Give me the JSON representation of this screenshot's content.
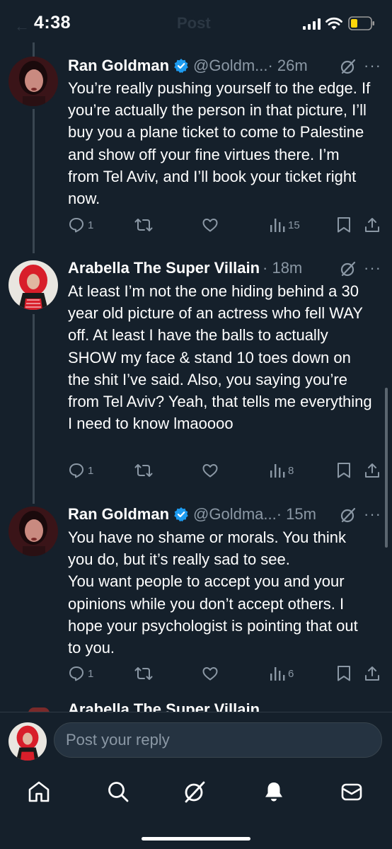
{
  "status_bar": {
    "time": "4:38",
    "ghost_title": "Post"
  },
  "tweets": [
    {
      "name": "Ran Goldman",
      "verified": true,
      "handle": "@Goldm...",
      "time": "· 26m",
      "text": "You’re really pushing yourself to the edge. If you’re actually the person in that picture, I’ll buy you a plane ticket to come to Palestine and show off your fine virtues there. I’m from Tel Aviv, and I’ll book your ticket right now.",
      "replies": "1",
      "reposts": "",
      "likes": "",
      "views": "15"
    },
    {
      "name": "Arabella The Super Villain",
      "verified": false,
      "handle": "",
      "time": "· 18m",
      "text": "At least I’m not the one hiding behind a 30 year old picture of an actress who fell WAY off. At least I have the balls to actually SHOW my face & stand 10 toes down on the shit I’ve said. Also, you saying you’re from Tel Aviv? Yeah, that tells me everything I need to know lmaoooo",
      "replies": "1",
      "reposts": "",
      "likes": "",
      "views": "8"
    },
    {
      "name": "Ran Goldman",
      "verified": true,
      "handle": "@Goldma...",
      "time": "· 15m",
      "text": "You have no shame or morals. You think you do, but it’s really sad to see.\nYou want people to accept you  and your opinions while you don’t accept others. I hope your psychologist is pointing that out to you.",
      "replies": "1",
      "reposts": "",
      "likes": "",
      "views": "6"
    }
  ],
  "peek_name": "Arabella The Super Villain",
  "reply_placeholder": "Post your reply",
  "nav": [
    "home-icon",
    "search-icon",
    "grok-icon",
    "notifications-icon",
    "messages-icon"
  ],
  "colors": {
    "background": "#15202b",
    "muted": "#8b98a5",
    "verified": "#1d9bf0",
    "text": "#ffffff"
  }
}
